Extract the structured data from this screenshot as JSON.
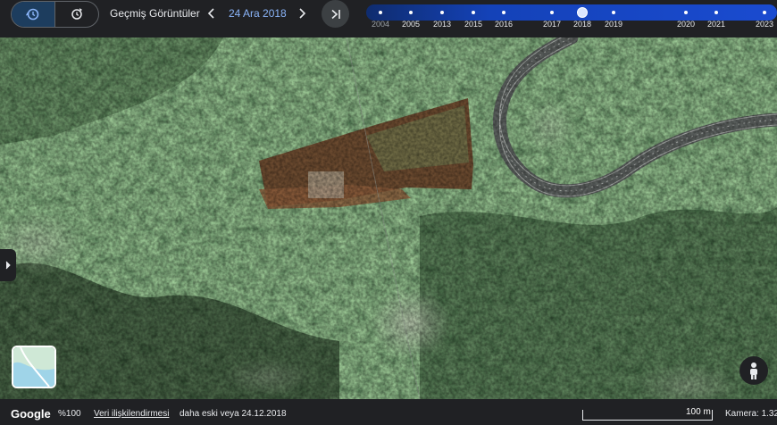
{
  "topbar": {
    "title": "Geçmiş Görüntüler",
    "date": "24 Ara 2018",
    "historical_icon": "history-icon",
    "refresh_icon": "refresh-icon",
    "prev_icon": "chevron-left-icon",
    "next_icon": "chevron-right-icon",
    "end_icon": "skip-to-end-icon"
  },
  "timeline": {
    "years": [
      "2004",
      "2005",
      "2013",
      "2015",
      "2016",
      "2017",
      "2018",
      "2019",
      "2020",
      "2021",
      "2023"
    ],
    "selected_year": "2018",
    "accent_color": "#1a4bd0"
  },
  "map": {
    "imagery": "satellite",
    "side_tab_icon": "chevron-right-icon",
    "layers_icon": "map-layers-icon",
    "pegman_icon": "pegman-icon"
  },
  "bottombar": {
    "logo": "Google",
    "zoom": "%100",
    "data_link": "Veri ilişkilendirmesi",
    "older_text": "daha eski veya 24.12.2018",
    "scale_label": "100 m",
    "camera": "Kamera: 1.32"
  }
}
